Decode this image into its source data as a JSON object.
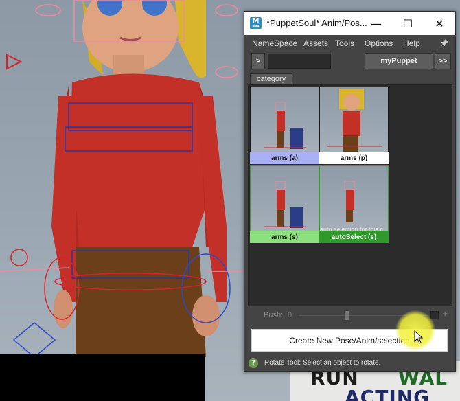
{
  "window": {
    "title": "*PuppetSoul* Anim/Pos...",
    "app_icon_letter": "M",
    "app_icon_sub": "aaa",
    "minimize": "—",
    "maximize": "☐",
    "close": "✕"
  },
  "menu": {
    "items": [
      "NameSpace",
      "Assets",
      "Tools",
      "Options",
      "Help"
    ]
  },
  "toolbar": {
    "left_arrow": ">",
    "puppet_label": "myPuppet",
    "right_arrows": ">>"
  },
  "tabs": [
    "category"
  ],
  "thumbnails": [
    {
      "label": "arms (a)",
      "state": "selected-blue"
    },
    {
      "label": "arms (p)",
      "state": "white"
    },
    {
      "label": "arms (s)",
      "state": "light-green"
    },
    {
      "label": "autoSelect (s)",
      "state": "dark-green",
      "overlay": "auto selection for this c"
    }
  ],
  "push": {
    "label": "Push:",
    "value": "0",
    "plus": "+"
  },
  "create_button": "Create New Pose/Anim/selection",
  "status": {
    "help": "?",
    "text": "Rotate Tool: Select an object to rotate."
  },
  "poster": {
    "words": [
      "RUN",
      "WAL",
      "ACTING"
    ]
  },
  "colors": {
    "selected_blue": "#a9b0f5",
    "green_light": "#8de07e",
    "green_dark": "#2f9a2b",
    "panel": "#444444"
  }
}
